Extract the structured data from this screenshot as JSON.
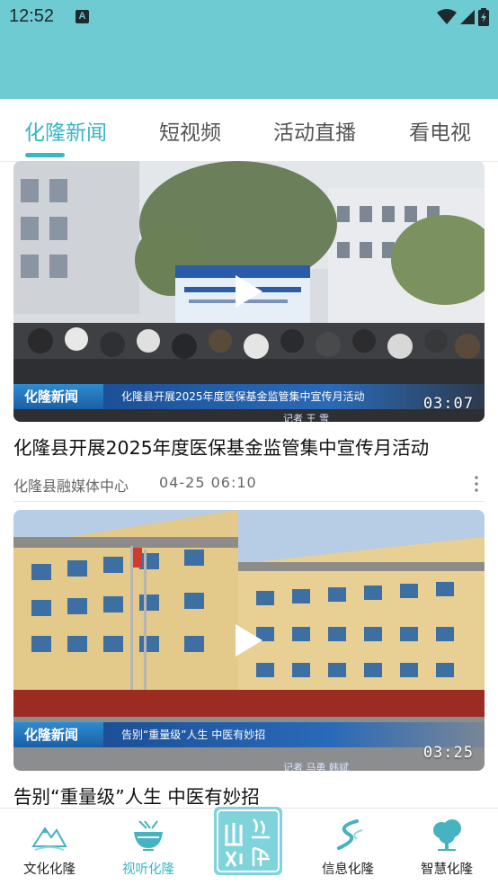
{
  "statusbar": {
    "time": "12:52",
    "notification": "A"
  },
  "tabs": [
    {
      "label": "化隆新闻",
      "active": true
    },
    {
      "label": "短视频",
      "active": false
    },
    {
      "label": "活动直播",
      "active": false
    },
    {
      "label": "看电视",
      "active": false
    }
  ],
  "articles": [
    {
      "title": "化隆县开展2025年度医保基金监管集中宣传月活动",
      "source": "化隆县融媒体中心",
      "time": "04-25  06:10",
      "duration": "03:07",
      "overlay_brand": "化隆新闻",
      "overlay_headline": "化隆县开展2025年度医保基金监管集中宣传月活动",
      "overlay_reporter": "记者  王 雪"
    },
    {
      "title": "告别“重量级”人生  中医有妙招",
      "duration": "03:25",
      "overlay_brand": "化隆新闻",
      "overlay_headline": "告别“重量级”人生 中医有妙招",
      "overlay_reporter": "记者    马勇  韩斌"
    }
  ],
  "bottom_nav": [
    {
      "label": "文化化隆",
      "icon": "mountain-icon",
      "active": false
    },
    {
      "label": "视听化隆",
      "icon": "bowl-icon",
      "active": true
    },
    {
      "label": "",
      "icon": "app-logo-icon",
      "active": false
    },
    {
      "label": "信息化隆",
      "icon": "river-icon",
      "active": false
    },
    {
      "label": "智慧化隆",
      "icon": "tree-icon",
      "active": false
    }
  ],
  "colors": {
    "header": "#6ecbd2",
    "accent": "#38b6c3"
  }
}
